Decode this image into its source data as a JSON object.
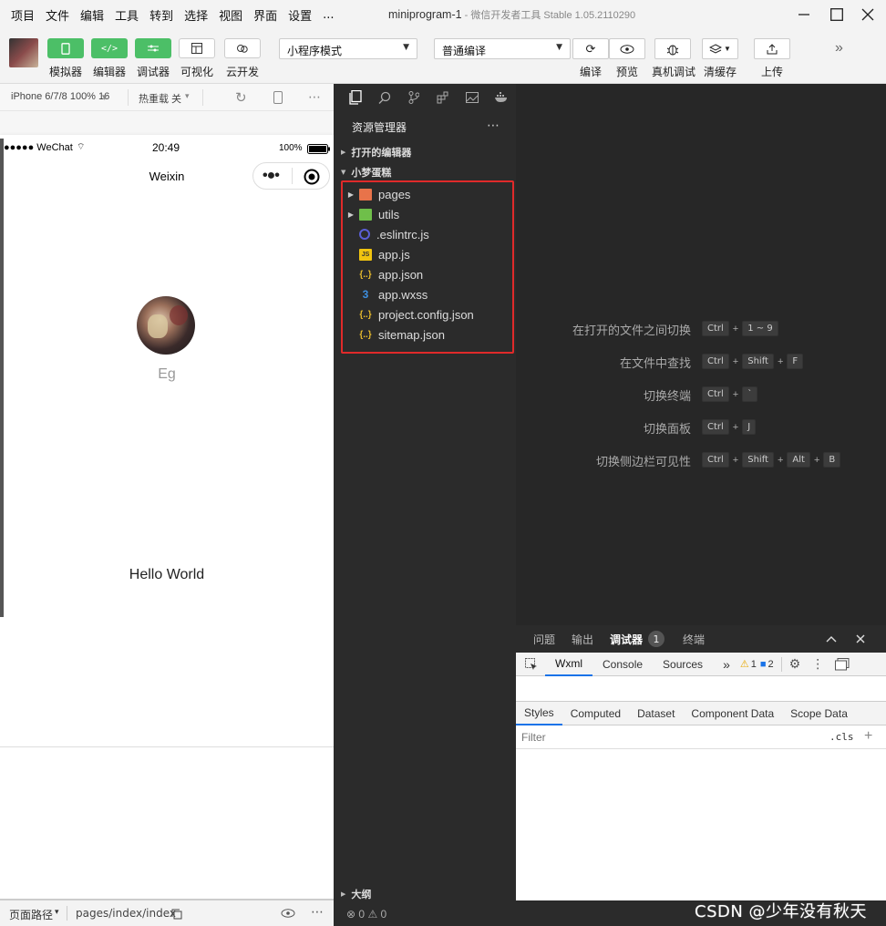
{
  "menu": [
    "项目",
    "文件",
    "编辑",
    "工具",
    "转到",
    "选择",
    "视图",
    "界面",
    "设置",
    "..."
  ],
  "window": {
    "project": "miniprogram-1",
    "separator": " - ",
    "app": "微信开发者工具 Stable 1.05.2110290"
  },
  "toolbar": {
    "simulator_label": "模拟器",
    "editor_label": "编辑器",
    "debugger_label": "调试器",
    "visual_label": "可视化",
    "cloud_label": "云开发",
    "mode_select": "小程序模式",
    "compile_select": "普通编译",
    "compile_label": "编译",
    "preview_label": "预览",
    "realdebug_label": "真机调试",
    "clearcache_label": "清缓存",
    "upload_label": "上传"
  },
  "simulator": {
    "device": "iPhone 6/7/8 100% 16",
    "hotreload": "热重载 关",
    "status_carrier": "●●●●● WeChat",
    "status_time": "20:49",
    "status_battery": "100%",
    "nav_title": "Weixin",
    "nickname": "Eg",
    "hello": "Hello World"
  },
  "pathbar": {
    "label": "页面路径",
    "path": "pages/index/index"
  },
  "explorer": {
    "title": "资源管理器",
    "open_editors": "打开的编辑器",
    "project": "小梦蛋糕",
    "files": [
      {
        "name": "pages",
        "type": "folder",
        "icon": "folder-pages-icon",
        "color": "#e8734a"
      },
      {
        "name": "utils",
        "type": "folder",
        "icon": "folder-utils-icon",
        "color": "#6fbf4a"
      },
      {
        "name": ".eslintrc.js",
        "type": "file",
        "icon": "eslint-icon",
        "color": "#5a5fd6"
      },
      {
        "name": "app.js",
        "type": "file",
        "icon": "js-icon",
        "color": "#f1c40f"
      },
      {
        "name": "app.json",
        "type": "file",
        "icon": "json-icon",
        "color": "#e5b92c"
      },
      {
        "name": "app.wxss",
        "type": "file",
        "icon": "css-icon",
        "color": "#3d8fe0"
      },
      {
        "name": "project.config.json",
        "type": "file",
        "icon": "json-icon",
        "color": "#e5b92c"
      },
      {
        "name": "sitemap.json",
        "type": "file",
        "icon": "json-icon",
        "color": "#e5b92c"
      }
    ],
    "outline": "大纲",
    "errors": "0",
    "warnings": "0"
  },
  "editor_hints": [
    {
      "label": "在打开的文件之间切换",
      "keys": [
        "Ctrl",
        "1 ~ 9"
      ]
    },
    {
      "label": "在文件中查找",
      "keys": [
        "Ctrl",
        "Shift",
        "F"
      ]
    },
    {
      "label": "切换终端",
      "keys": [
        "Ctrl",
        "`"
      ]
    },
    {
      "label": "切换面板",
      "keys": [
        "Ctrl",
        "J"
      ]
    },
    {
      "label": "切换侧边栏可见性",
      "keys": [
        "Ctrl",
        "Shift",
        "Alt",
        "B"
      ]
    }
  ],
  "debug_tabs": {
    "problems": "问题",
    "output": "输出",
    "debugger": "调试器",
    "debugger_badge": "1",
    "terminal": "终端"
  },
  "devtools": {
    "tabs": [
      "Wxml",
      "Console",
      "Sources"
    ],
    "more": "»",
    "warn_count": "1",
    "info_count": "2",
    "style_tabs": [
      "Styles",
      "Computed",
      "Dataset",
      "Component Data",
      "Scope Data"
    ],
    "filter_placeholder": "Filter",
    "cls": ".cls",
    "add": "+"
  },
  "watermark": "CSDN @少年没有秋天",
  "colors": {
    "green": "#4cbf67",
    "highlight_border": "#e02a2a",
    "dark_bg": "#2b2b2b",
    "editor_bg": "#272727",
    "tab_active": "#1a73e8"
  }
}
